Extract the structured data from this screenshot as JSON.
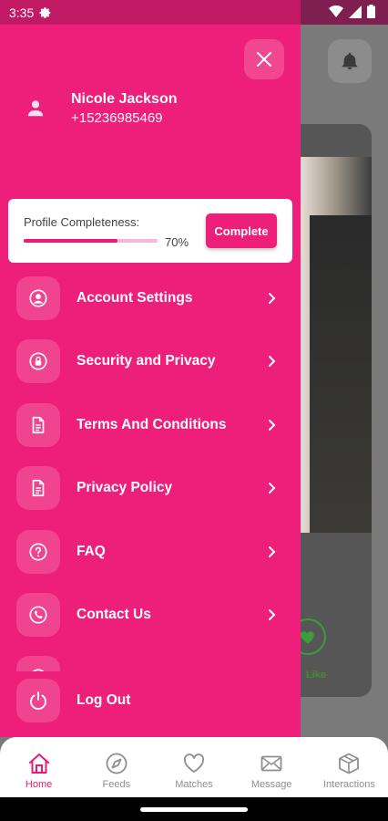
{
  "status_bar": {
    "time": "3:35"
  },
  "profile": {
    "name": "Nicole Jackson",
    "phone": "+15236985469"
  },
  "completeness": {
    "label": "Profile Completeness:",
    "percent_text": "70%",
    "progress": 0.7,
    "button_label": "Complete"
  },
  "menu": [
    {
      "label": "Account Settings",
      "icon": "account-circle-icon"
    },
    {
      "label": "Security and Privacy",
      "icon": "lock-icon"
    },
    {
      "label": "Terms And Conditions",
      "icon": "document-icon"
    },
    {
      "label": "Privacy Policy",
      "icon": "document-icon"
    },
    {
      "label": "FAQ",
      "icon": "help-circle-icon"
    },
    {
      "label": "Contact Us",
      "icon": "phone-icon"
    }
  ],
  "logout": {
    "label": "Log Out"
  },
  "background": {
    "like_label": "Like"
  },
  "bottom_nav": [
    {
      "label": "Home",
      "icon": "home-icon",
      "active": true
    },
    {
      "label": "Feeds",
      "icon": "compass-icon",
      "active": false
    },
    {
      "label": "Matches",
      "icon": "heart-icon",
      "active": false
    },
    {
      "label": "Message",
      "icon": "mail-icon",
      "active": false
    },
    {
      "label": "Interactions",
      "icon": "box-icon",
      "active": false
    }
  ],
  "colors": {
    "accent": "#ee1f7b",
    "accent_dark": "#c11963",
    "nav_inactive": "#8f8f8f"
  }
}
